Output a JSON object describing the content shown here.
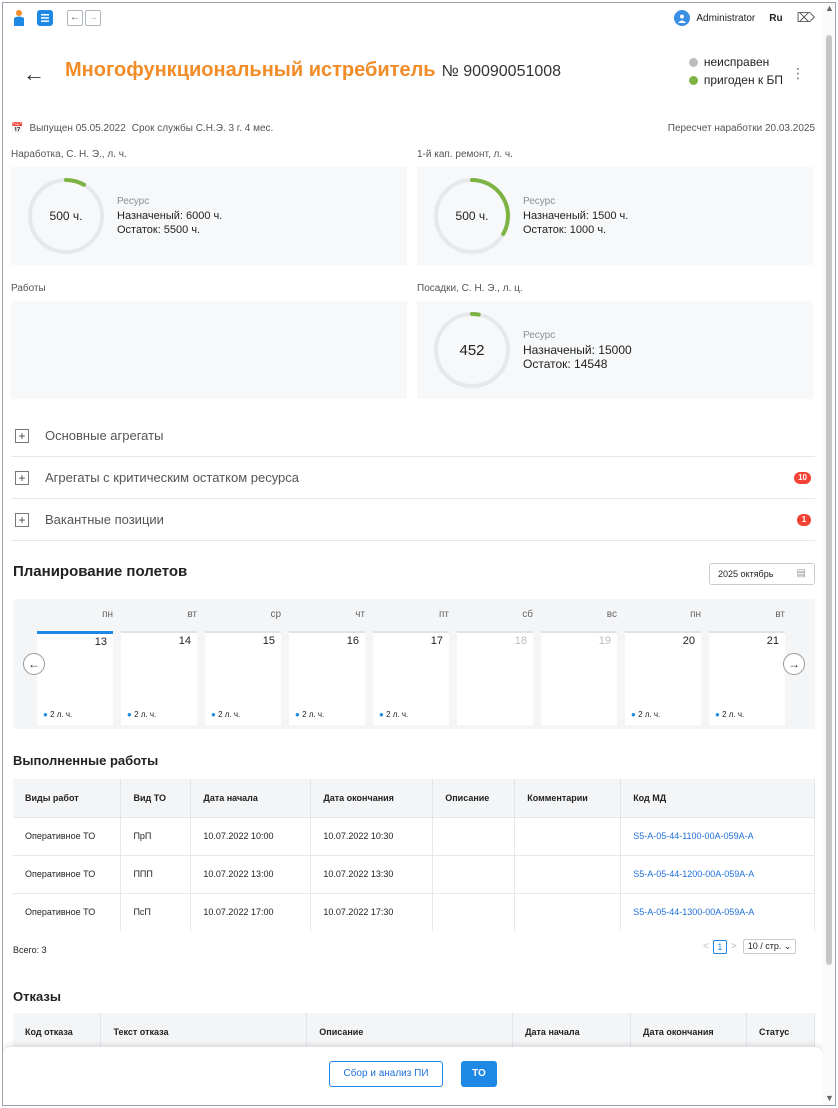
{
  "topbar": {
    "user": "Administrator",
    "lang": "Ru"
  },
  "header": {
    "title": "Многофункциональный истребитель",
    "serial": "№ 90090051008",
    "status1": "неисправен",
    "status2": "пригоден к БП"
  },
  "meta": {
    "issued": "Выпущен 05.05.2022",
    "service": "Срок службы С.Н.Э. 3 г. 4 мес.",
    "recalc": "Пересчет наработки 20.03.2025"
  },
  "cards": {
    "c1": {
      "label": "Наработка, С. Н. Э., л. ч.",
      "value": "500 ч.",
      "res": "Ресурс",
      "assigned": "Назначеный: 6000 ч.",
      "remaining": "Остаток: 5500 ч.",
      "fraction": 0.083
    },
    "c2": {
      "label": "1-й кап. ремонт, л. ч.",
      "value": "500 ч.",
      "res": "Ресурс",
      "assigned": "Назначеный: 1500 ч.",
      "remaining": "Остаток: 1000 ч.",
      "fraction": 0.333
    },
    "c3": {
      "label": "Работы"
    },
    "c4": {
      "label": "Посадки, С. Н. Э., л. ц.",
      "value": "452",
      "res": "Ресурс",
      "assigned": "Назначеный: 15000",
      "remaining": "Остаток: 14548",
      "fraction": 0.03
    }
  },
  "accordion": {
    "a1": "Основные агрегаты",
    "a2": "Агрегаты с критическим остатком ресурса",
    "a2_badge": "10",
    "a3": "Вакантные позиции",
    "a3_badge": "1"
  },
  "planning": {
    "title": "Планирование полетов",
    "month": "2025 октябрь",
    "days": [
      {
        "name": "пн",
        "num": "13",
        "info": "2 л. ч.",
        "active": true,
        "muted": false
      },
      {
        "name": "вт",
        "num": "14",
        "info": "2 л. ч.",
        "active": false,
        "muted": false
      },
      {
        "name": "ср",
        "num": "15",
        "info": "2 л. ч.",
        "active": false,
        "muted": false
      },
      {
        "name": "чт",
        "num": "16",
        "info": "2 л. ч.",
        "active": false,
        "muted": false
      },
      {
        "name": "пт",
        "num": "17",
        "info": "2 л. ч.",
        "active": false,
        "muted": false
      },
      {
        "name": "сб",
        "num": "18",
        "info": "",
        "active": false,
        "muted": true
      },
      {
        "name": "вс",
        "num": "19",
        "info": "",
        "active": false,
        "muted": true
      },
      {
        "name": "пн",
        "num": "20",
        "info": "2 л. ч.",
        "active": false,
        "muted": false
      },
      {
        "name": "вт",
        "num": "21",
        "info": "2 л. ч.",
        "active": false,
        "muted": false
      }
    ]
  },
  "works": {
    "title": "Выполненные работы",
    "headers": [
      "Виды работ",
      "Вид ТО",
      "Дата начала",
      "Дата окончания",
      "Описание",
      "Комментарии",
      "Код МД"
    ],
    "rows": [
      [
        "Оперативное ТО",
        "ПрП",
        "10.07.2022 10:00",
        "10.07.2022 10:30",
        "",
        "",
        "S5-A-05-44-1100-00A-059A-A"
      ],
      [
        "Оперативное ТО",
        "ППП",
        "10.07.2022 13:00",
        "10.07.2022 13:30",
        "",
        "",
        "S5-A-05-44-1200-00A-059A-A"
      ],
      [
        "Оперативное ТО",
        "ПсП",
        "10.07.2022 17:00",
        "10.07.2022 17:30",
        "",
        "",
        "S5-A-05-44-1300-00A-059A-A"
      ]
    ],
    "total": "Всего: 3",
    "page": "1",
    "pagesize": "10 / стр."
  },
  "failures": {
    "title": "Отказы",
    "headers": [
      "Код отказа",
      "Текст отказа",
      "Описание",
      "Дата начала",
      "Дата окончания",
      "Статус"
    ]
  },
  "footer": {
    "btn1": "Сбор и анализ ПИ",
    "btn2": "ТО"
  },
  "colors": {
    "accent": "#f28c28",
    "primary": "#1e88e5",
    "gauge": "#7cb342",
    "badge": "#f44336"
  }
}
